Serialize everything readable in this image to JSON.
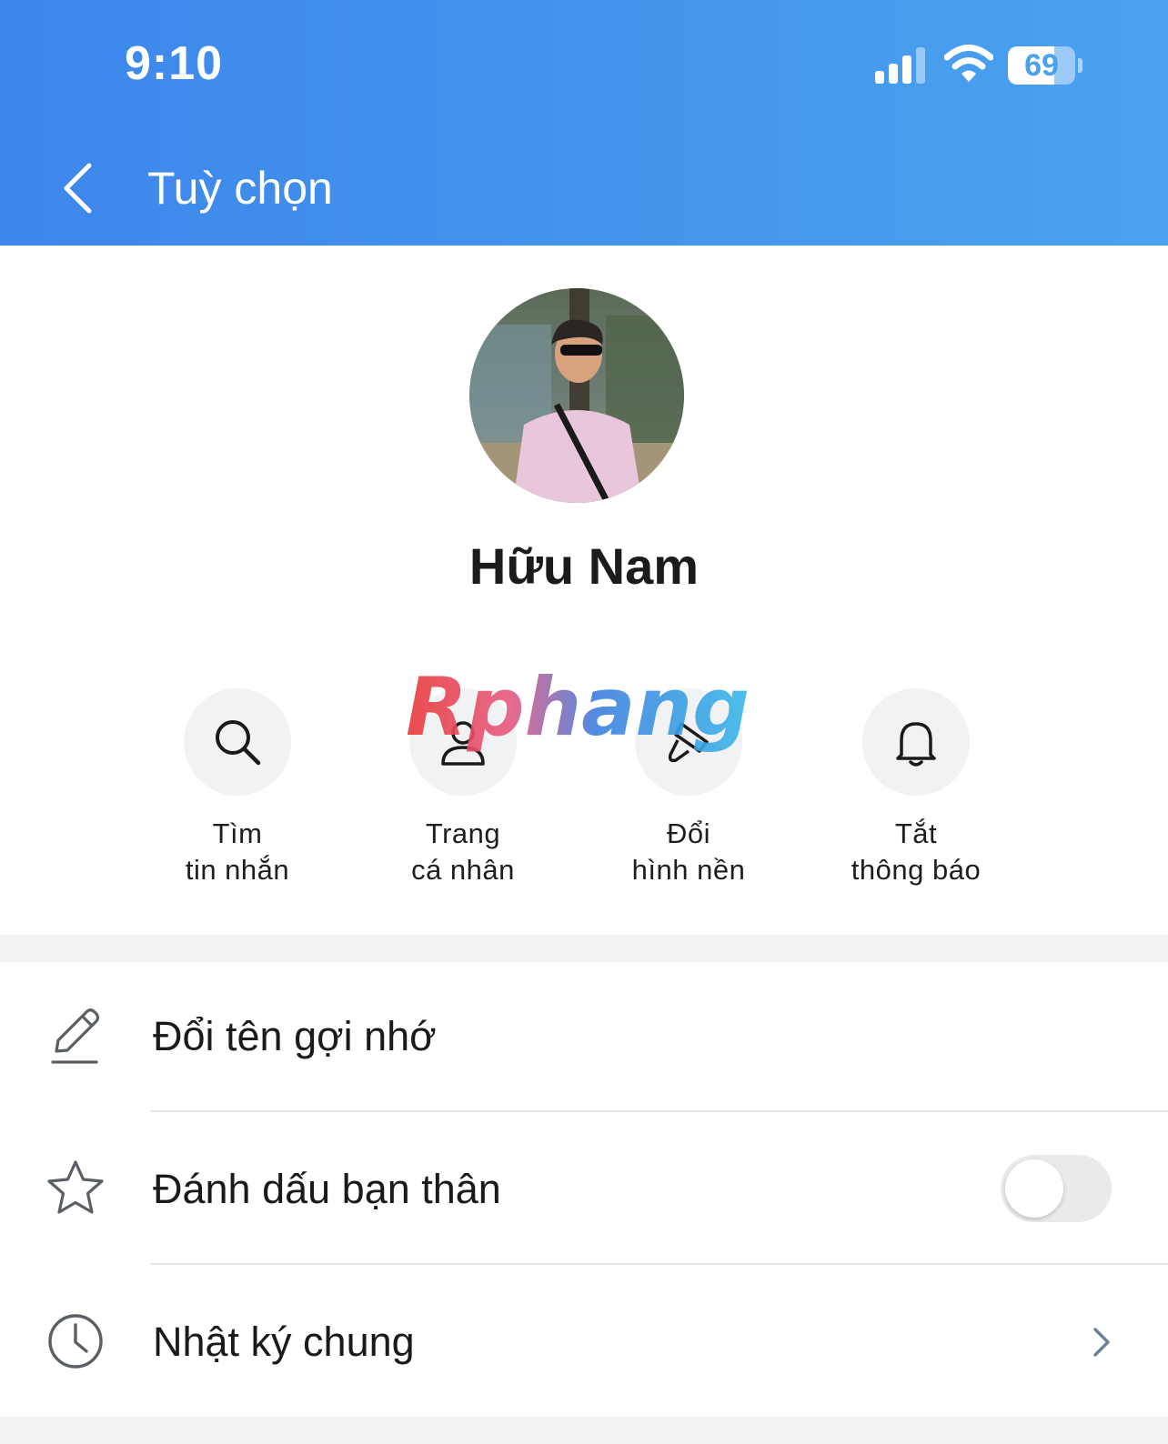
{
  "status_bar": {
    "time": "9:10",
    "battery_level": "69",
    "battery_fraction": 0.69,
    "icons": [
      "cellular-signal-icon",
      "wifi-icon",
      "battery-icon"
    ]
  },
  "header": {
    "title": "Tuỳ chọn",
    "back_icon": "chevron-left-icon",
    "background_colors": [
      "#3d86ec",
      "#4aa2ee"
    ]
  },
  "profile": {
    "name": "Hữu Nam"
  },
  "watermark": "Rphang",
  "actions": [
    {
      "icon": "search-icon",
      "line1": "Tìm",
      "line2": "tin nhắn"
    },
    {
      "icon": "person-icon",
      "line1": "Trang",
      "line2": "cá nhân"
    },
    {
      "icon": "paint-brush-icon",
      "line1": "Đổi",
      "line2": "hình nền"
    },
    {
      "icon": "bell-icon",
      "line1": "Tắt",
      "line2": "thông báo"
    }
  ],
  "options": [
    {
      "icon": "pencil-icon",
      "label": "Đổi tên gợi nhớ",
      "control": "none"
    },
    {
      "icon": "star-icon",
      "label": "Đánh dấu bạn thân",
      "control": "toggle",
      "toggle_on": false
    },
    {
      "icon": "clock-icon",
      "label": "Nhật ký chung",
      "control": "chevron"
    }
  ]
}
